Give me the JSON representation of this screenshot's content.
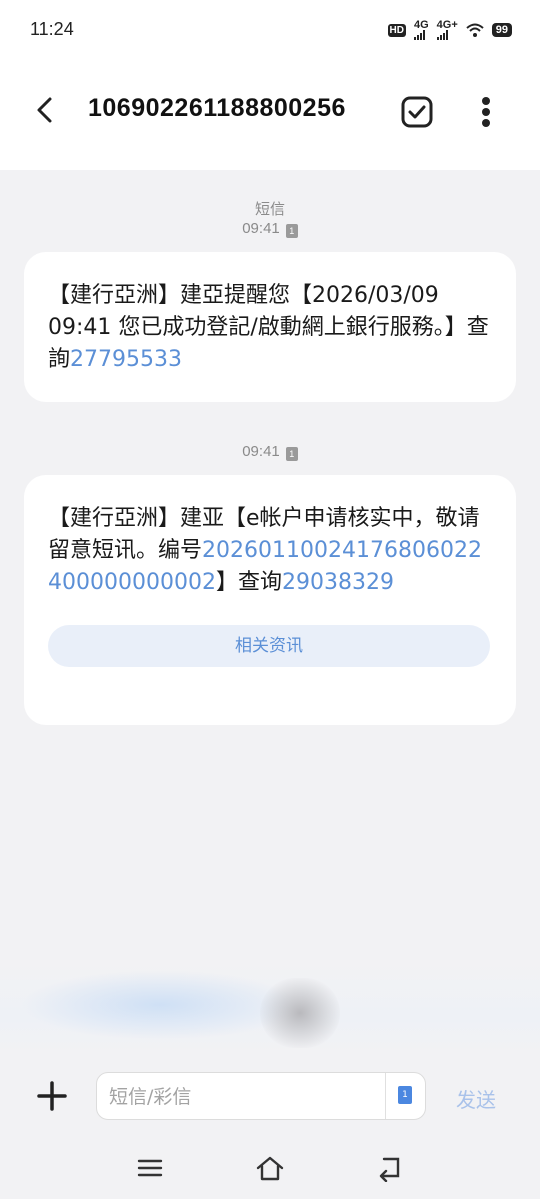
{
  "status_bar": {
    "time": "11:24",
    "hd_label": "HD",
    "net1": "4G",
    "net2": "4G+",
    "battery": "99"
  },
  "header": {
    "title": "106902261188800256"
  },
  "conversation": {
    "day_label": "短信",
    "messages": [
      {
        "time": "09:41",
        "sim": "1",
        "text": "【建行亞洲】建亞提醒您【2026/03/09 09:41 您已成功登記/啟動網上銀行服務。】查詢",
        "link": "27795533"
      },
      {
        "time": "09:41",
        "sim": "1",
        "text_before": "【建行亞洲】建亚【e帐户申请核实中，敬请留意短讯。编号",
        "ref_number": "20260110024176806022400000000002",
        "text_mid": "】查询",
        "link": "29038329",
        "related_button": "相关资讯"
      }
    ]
  },
  "composer": {
    "placeholder": "短信/彩信",
    "sim_label": "1",
    "send_label": "发送"
  },
  "colors": {
    "link": "#5b8fd6",
    "background": "#f2f2f4",
    "bubble": "#ffffff"
  }
}
